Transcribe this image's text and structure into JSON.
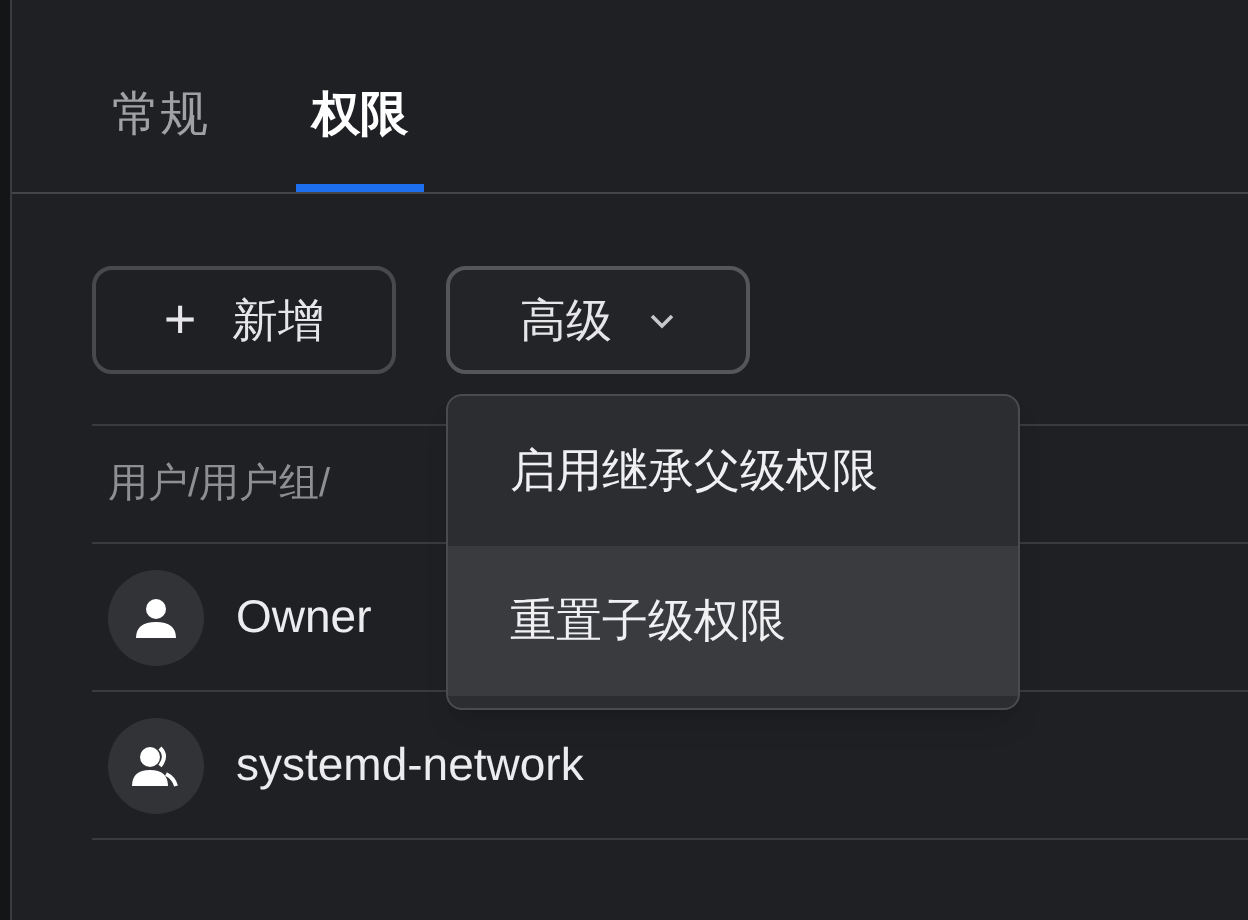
{
  "tabs": [
    {
      "label": "常规",
      "selected": false
    },
    {
      "label": "权限",
      "selected": true
    }
  ],
  "toolbar": {
    "add_button": {
      "icon": "+",
      "label": "新增"
    },
    "advanced_button": {
      "label": "高级",
      "expanded": true
    }
  },
  "table": {
    "columns": [
      "用户/用户组/"
    ],
    "rows": [
      {
        "kind": "user",
        "name": "Owner"
      },
      {
        "kind": "group",
        "name": "systemd-network"
      }
    ]
  },
  "dropdown_menu": {
    "items": [
      {
        "label": "启用继承父级权限",
        "selected": false
      },
      {
        "label": "重置子级权限",
        "selected": true
      }
    ]
  }
}
